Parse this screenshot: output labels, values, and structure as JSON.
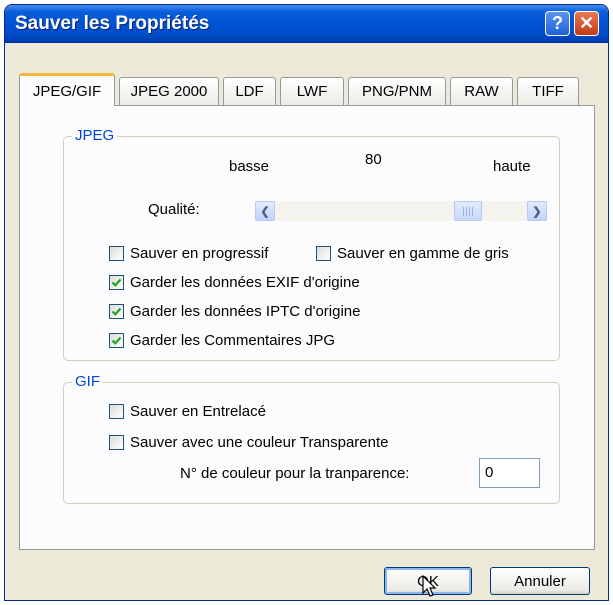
{
  "window": {
    "title": "Sauver les Propriétés",
    "help_label": "?",
    "close_label": "✕"
  },
  "tabs": [
    "JPEG/GIF",
    "JPEG 2000",
    "LDF",
    "LWF",
    "PNG/PNM",
    "RAW",
    "TIFF"
  ],
  "active_tab": "JPEG/GIF",
  "jpeg": {
    "legend": "JPEG",
    "low_label": "basse",
    "value": "80",
    "high_label": "haute",
    "quality_label": "Qualité:",
    "quality_fraction": 0.8,
    "progressive": {
      "label": "Sauver en progressif",
      "checked": false
    },
    "grayscale": {
      "label": "Sauver en gamme de gris",
      "checked": false
    },
    "exif": {
      "label": "Garder les données EXIF d'origine",
      "checked": true
    },
    "iptc": {
      "label": "Garder les données IPTC d'origine",
      "checked": true
    },
    "comments": {
      "label": "Garder les Commentaires JPG",
      "checked": true
    }
  },
  "gif": {
    "legend": "GIF",
    "interlaced": {
      "label": "Sauver en Entrelacé",
      "checked": false
    },
    "transparent": {
      "label": "Sauver avec une couleur Transparente",
      "checked": false
    },
    "color_index_label": "N° de couleur  pour la tranparence:",
    "color_index_value": "0"
  },
  "buttons": {
    "ok": "OK",
    "cancel": "Annuler"
  },
  "colors": {
    "title_bar": "#0053d6",
    "group_legend": "#0046d5",
    "active_tab_accent": "#f5b73c",
    "check_mark": "#21a121"
  }
}
